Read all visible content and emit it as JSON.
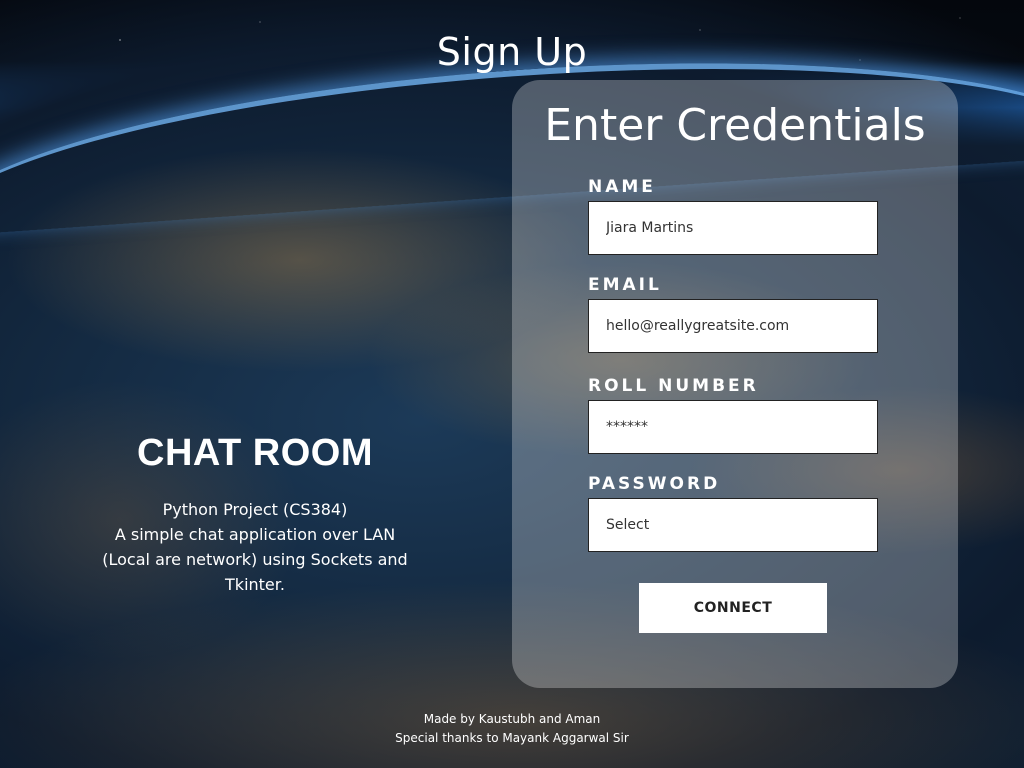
{
  "page": {
    "title": "Sign Up"
  },
  "intro": {
    "heading": "CHAT ROOM",
    "description_lines": [
      "Python Project (CS384)",
      "A simple chat application over LAN",
      "(Local are network) using Sockets and",
      "Tkinter."
    ]
  },
  "form": {
    "title": "Enter Credentials",
    "fields": [
      {
        "label": "NAME",
        "value": "Jiara Martins"
      },
      {
        "label": "EMAIL",
        "value": "hello@reallygreatsite.com"
      },
      {
        "label": "ROLL NUMBER",
        "value": "******"
      },
      {
        "label": "PASSWORD",
        "value": "Select"
      }
    ],
    "submit_label": "CONNECT"
  },
  "footer": {
    "credits": "Made by Kaustubh and Aman",
    "thanks": "Special thanks to Mayank Aggarwal Sir"
  }
}
